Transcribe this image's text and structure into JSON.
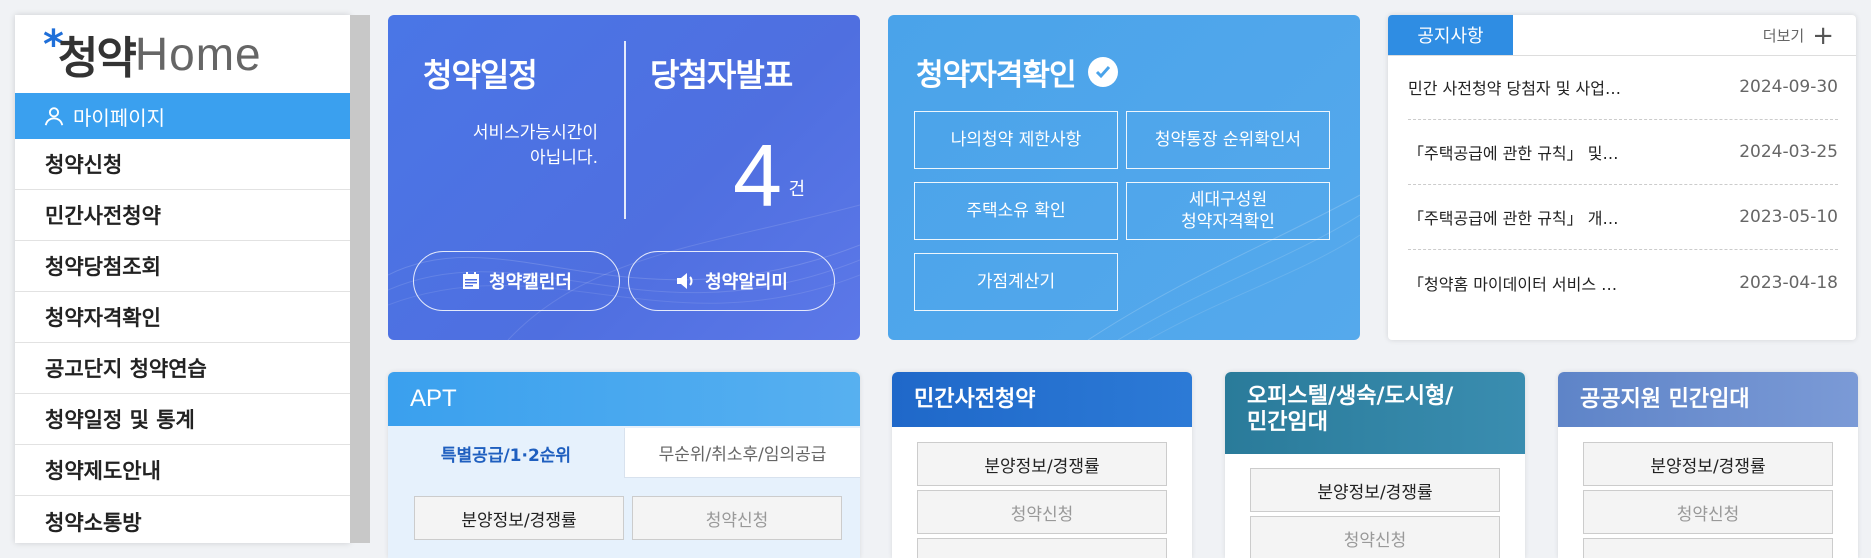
{
  "sidebar": {
    "logo_star": "*",
    "logo_ko": "청약",
    "logo_en": "Home",
    "mypage_label": "마이페이지",
    "items": [
      {
        "label": "청약신청"
      },
      {
        "label": "민간사전청약"
      },
      {
        "label": "청약당첨조회"
      },
      {
        "label": "청약자격확인"
      },
      {
        "label": "공고단지 청약연습"
      },
      {
        "label": "청약일정 및 통계"
      },
      {
        "label": "청약제도안내"
      },
      {
        "label": "청약소통방"
      }
    ]
  },
  "schedule_card": {
    "title_left": "청약일정",
    "title_right": "당첨자발표",
    "message_line1": "서비스가능시간이",
    "message_line2": "아닙니다.",
    "count": "4",
    "count_unit": "건",
    "calendar_button": "청약캘린더",
    "alarm_button": "청약알리미"
  },
  "qualification_card": {
    "title": "청약자격확인",
    "buttons": {
      "restrictions": "나의청약 제한사항",
      "ranking_cert": "청약통장 순위확인서",
      "house_ownership": "주택소유 확인",
      "household_line1": "세대구성원",
      "household_line2": "청약자격확인",
      "score_calc": "가점계산기"
    }
  },
  "notice_card": {
    "tab_label": "공지사항",
    "more_label": "더보기",
    "items": [
      {
        "title": "민간 사전청약 당첨자 및 사업…",
        "date": "2024-09-30"
      },
      {
        "title": "「주택공급에 관한 규칙」 및…",
        "date": "2024-03-25"
      },
      {
        "title": "「주택공급에 관한 규칙」 개…",
        "date": "2023-05-10"
      },
      {
        "title": "「청약홈 마이데이터 서비스 …",
        "date": "2023-04-18"
      }
    ]
  },
  "apt_card": {
    "title": "APT",
    "tab_active": "특별공급/1·2순위",
    "tab_inactive": "무순위/취소후/임의공급",
    "button_info": "분양정보/경쟁률",
    "button_apply": "청약신청"
  },
  "private_card": {
    "title": "민간사전청약",
    "button_info": "분양정보/경쟁률",
    "button_apply": "청약신청"
  },
  "officetel_card": {
    "title_line1": "오피스텔/생숙/도시형/",
    "title_line2": "민간임대",
    "button_info": "분양정보/경쟁률",
    "button_apply": "청약신청"
  },
  "public_card": {
    "title": "공공지원 민간임대",
    "button_info": "분양정보/경쟁률",
    "button_apply": "청약신청"
  },
  "colors": {
    "sidebar_active": "#3aa0ef",
    "schedule_bg": "#4f6fe0",
    "qualification_bg": "#4aa3ea",
    "notice_tab": "#2f8de3"
  }
}
